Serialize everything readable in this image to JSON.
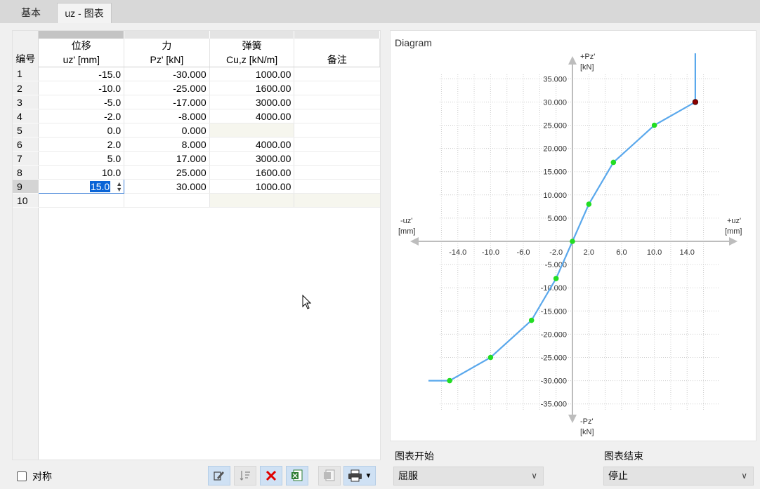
{
  "tabs": [
    {
      "label": "基本"
    },
    {
      "label": "uz - 图表"
    }
  ],
  "table": {
    "row_header": "编号",
    "columns": [
      {
        "top": "位移",
        "bottom": "uz' [mm]"
      },
      {
        "top": "力",
        "bottom": "Pz' [kN]"
      },
      {
        "top": "弹簧",
        "bottom": "Cu,z [kN/m]"
      },
      {
        "top": "",
        "bottom": "备注"
      }
    ],
    "rows": [
      {
        "no": "1",
        "uz": "-15.0",
        "pz": "-30.000",
        "c": "1000.00",
        "note": ""
      },
      {
        "no": "2",
        "uz": "-10.0",
        "pz": "-25.000",
        "c": "1600.00",
        "note": ""
      },
      {
        "no": "3",
        "uz": "-5.0",
        "pz": "-17.000",
        "c": "3000.00",
        "note": ""
      },
      {
        "no": "4",
        "uz": "-2.0",
        "pz": "-8.000",
        "c": "4000.00",
        "note": ""
      },
      {
        "no": "5",
        "uz": "0.0",
        "pz": "0.000",
        "c": "",
        "note": ""
      },
      {
        "no": "6",
        "uz": "2.0",
        "pz": "8.000",
        "c": "4000.00",
        "note": ""
      },
      {
        "no": "7",
        "uz": "5.0",
        "pz": "17.000",
        "c": "3000.00",
        "note": ""
      },
      {
        "no": "8",
        "uz": "10.0",
        "pz": "25.000",
        "c": "1600.00",
        "note": ""
      },
      {
        "no": "9",
        "uz": "15.0",
        "pz": "30.000",
        "c": "1000.00",
        "note": ""
      },
      {
        "no": "10",
        "uz": "",
        "pz": "",
        "c": "",
        "note": ""
      }
    ],
    "edit_value": "15.0"
  },
  "symmetric_label": "对称",
  "toolbar": {
    "icons": [
      "edit-table-icon",
      "sort-icon",
      "delete-icon",
      "export-excel-icon",
      "import-excel-icon",
      "print-icon"
    ]
  },
  "diagram": {
    "title": "Diagram",
    "y_pos_label": "+Pz'",
    "y_pos_unit": "[kN]",
    "y_neg_label": "-Pz'",
    "y_neg_unit": "[kN]",
    "x_pos_label": "+uz'",
    "x_pos_unit": "[mm]",
    "x_neg_label": "-uz'",
    "x_neg_unit": "[mm]"
  },
  "chart_data": {
    "type": "line",
    "x": [
      -15.0,
      -10.0,
      -5.0,
      -2.0,
      0.0,
      2.0,
      5.0,
      10.0,
      15.0
    ],
    "y": [
      -30.0,
      -25.0,
      -17.0,
      -8.0,
      0.0,
      8.0,
      17.0,
      25.0,
      30.0
    ],
    "xlim": [
      -18,
      18
    ],
    "ylim": [
      -37,
      37
    ],
    "x_ticks": [
      "-14.0",
      "-10.0",
      "-6.0",
      "-2.0",
      "2.0",
      "6.0",
      "10.0",
      "14.0"
    ],
    "x_tick_values": [
      -14,
      -10,
      -6,
      -2,
      2,
      6,
      10,
      14
    ],
    "y_ticks": [
      "35.000",
      "30.000",
      "25.000",
      "20.000",
      "15.000",
      "10.000",
      "5.000",
      "-5.000",
      "-10.000",
      "-15.000",
      "-20.000",
      "-25.000",
      "-30.000",
      "-35.000"
    ],
    "y_tick_values": [
      35,
      30,
      25,
      20,
      15,
      10,
      5,
      -5,
      -10,
      -15,
      -20,
      -25,
      -30,
      -35
    ],
    "grid": true,
    "line_color": "#5aa8ec",
    "point_color": "#22dd22",
    "selected_point_color": "#8b0000",
    "selected_index": 8
  },
  "chart_start": {
    "label": "图表开始",
    "value": "屈服"
  },
  "chart_end": {
    "label": "图表结束",
    "value": "停止"
  }
}
